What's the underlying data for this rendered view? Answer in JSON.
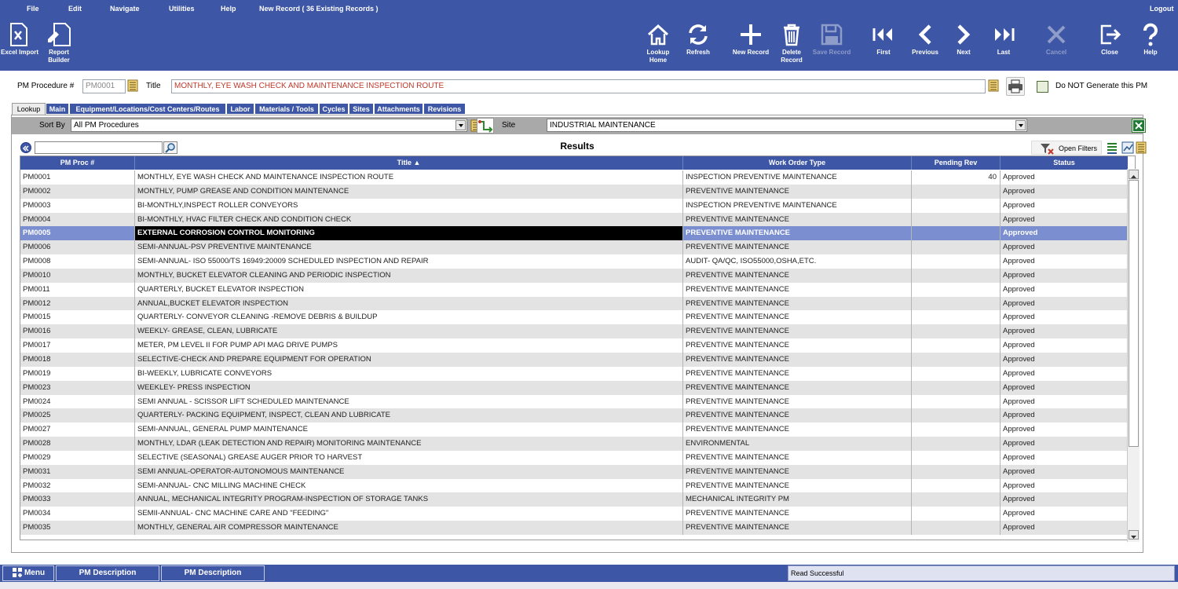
{
  "menu": {
    "file": "File",
    "edit": "Edit",
    "navigate": "Navigate",
    "utilities": "Utilities",
    "help": "Help",
    "record_info": "New Record  ( 36 Existing Records )",
    "logout": "Logout"
  },
  "toolbar": {
    "excel_import": "Excel Import",
    "report_builder_1": "Report",
    "report_builder_2": "Builder",
    "lookup_home_1": "Lookup",
    "lookup_home_2": "Home",
    "refresh": "Refresh",
    "new_record": "New Record",
    "delete_record_1": "Delete",
    "delete_record_2": "Record",
    "save_record": "Save Record",
    "first": "First",
    "previous": "Previous",
    "next": "Next",
    "last": "Last",
    "cancel": "Cancel",
    "close": "Close",
    "help": "Help"
  },
  "header": {
    "pm_procedure_label": "PM Procedure #",
    "pm_procedure_value": "PM0001",
    "title_label": "Title",
    "title_value": "MONTHLY,  EYE WASH CHECK AND MAINTENANCE INSPECTION ROUTE",
    "do_not_generate_label": "Do NOT Generate this PM"
  },
  "tabs": [
    "Lookup",
    "Main",
    "Equipment/Locations/Cost Centers/Routes",
    "Labor",
    "Materials / Tools",
    "Cycles",
    "Sites",
    "Attachments",
    "Revisions"
  ],
  "sortbar": {
    "sort_by_label": "Sort By",
    "sort_by_value": "All PM Procedures",
    "site_label": "Site",
    "site_value": "INDUSTRIAL  MAINTENANCE"
  },
  "results": {
    "title": "Results",
    "open_filters": "Open Filters",
    "columns": [
      "PM Proc #",
      "Title ▲",
      "Work Order Type",
      "Pending Rev",
      "Status"
    ]
  },
  "rows": [
    {
      "id": "PM0001",
      "title": "MONTHLY,  EYE WASH CHECK AND MAINTENANCE INSPECTION ROUTE",
      "type": "INSPECTION PREVENTIVE MAINTENANCE",
      "rev": "40",
      "status": "Approved"
    },
    {
      "id": "PM0002",
      "title": "MONTHLY, PUMP GREASE AND CONDITION MAINTENANCE",
      "type": "PREVENTIVE MAINTENANCE",
      "rev": "",
      "status": "Approved"
    },
    {
      "id": "PM0003",
      "title": "BI-MONTHLY,INSPECT ROLLER CONVEYORS",
      "type": "INSPECTION PREVENTIVE MAINTENANCE",
      "rev": "",
      "status": "Approved"
    },
    {
      "id": "PM0004",
      "title": "BI-MONTHLY, HVAC FILTER CHECK AND CONDITION CHECK",
      "type": "PREVENTIVE MAINTENANCE",
      "rev": "",
      "status": "Approved"
    },
    {
      "id": "PM0005",
      "title": "EXTERNAL CORROSION CONTROL MONITORING",
      "type": "PREVENTIVE MAINTENANCE",
      "rev": "",
      "status": "Approved",
      "selected": true
    },
    {
      "id": "PM0006",
      "title": "SEMI-ANNUAL-PSV PREVENTIVE MAINTENANCE",
      "type": "PREVENTIVE MAINTENANCE",
      "rev": "",
      "status": "Approved"
    },
    {
      "id": "PM0008",
      "title": "SEMI-ANNUAL- ISO 55000/TS 16949:20009 SCHEDULED INSPECTION AND REPAIR",
      "type": "AUDIT- QA/QC, ISO55000,OSHA,ETC.",
      "rev": "",
      "status": "Approved"
    },
    {
      "id": "PM0010",
      "title": "MONTHLY,  BUCKET ELEVATOR CLEANING AND PERIODIC INSPECTION",
      "type": "PREVENTIVE MAINTENANCE",
      "rev": "",
      "status": "Approved"
    },
    {
      "id": "PM0011",
      "title": "QUARTERLY, BUCKET ELEVATOR INSPECTION",
      "type": "PREVENTIVE MAINTENANCE",
      "rev": "",
      "status": "Approved"
    },
    {
      "id": "PM0012",
      "title": "ANNUAL,BUCKET ELEVATOR INSPECTION",
      "type": "PREVENTIVE MAINTENANCE",
      "rev": "",
      "status": "Approved"
    },
    {
      "id": "PM0015",
      "title": "QUARTERLY- CONVEYOR CLEANING -REMOVE DEBRIS & BUILDUP",
      "type": "PREVENTIVE MAINTENANCE",
      "rev": "",
      "status": "Approved"
    },
    {
      "id": "PM0016",
      "title": "WEEKLY- GREASE, CLEAN, LUBRICATE",
      "type": "PREVENTIVE MAINTENANCE",
      "rev": "",
      "status": "Approved"
    },
    {
      "id": "PM0017",
      "title": "METER, PM LEVEL II FOR PUMP  API MAG DRIVE PUMPS",
      "type": "PREVENTIVE MAINTENANCE",
      "rev": "",
      "status": "Approved"
    },
    {
      "id": "PM0018",
      "title": "SELECTIVE-CHECK AND PREPARE EQUIPMENT FOR OPERATION",
      "type": "PREVENTIVE MAINTENANCE",
      "rev": "",
      "status": "Approved"
    },
    {
      "id": "PM0019",
      "title": "BI-WEEKLY,  LUBRICATE CONVEYORS",
      "type": "PREVENTIVE MAINTENANCE",
      "rev": "",
      "status": "Approved"
    },
    {
      "id": "PM0023",
      "title": "WEEKLEY- PRESS INSPECTION",
      "type": "PREVENTIVE MAINTENANCE",
      "rev": "",
      "status": "Approved"
    },
    {
      "id": "PM0024",
      "title": "SEMI ANNUAL - SCISSOR LIFT SCHEDULED MAINTENANCE",
      "type": "PREVENTIVE MAINTENANCE",
      "rev": "",
      "status": "Approved"
    },
    {
      "id": "PM0025",
      "title": "QUARTERLY- PACKING EQUIPMENT, INSPECT, CLEAN AND LUBRICATE",
      "type": "PREVENTIVE MAINTENANCE",
      "rev": "",
      "status": "Approved"
    },
    {
      "id": "PM0027",
      "title": "SEMI-ANNUAL, GENERAL  PUMP MAINTENANCE",
      "type": "PREVENTIVE MAINTENANCE",
      "rev": "",
      "status": "Approved"
    },
    {
      "id": "PM0028",
      "title": "MONTHLY,  LDAR (LEAK DETECTION AND REPAIR) MONITORING MAINTENANCE",
      "type": "ENVIRONMENTAL",
      "rev": "",
      "status": "Approved"
    },
    {
      "id": "PM0029",
      "title": "SELECTIVE (SEASONAL) GREASE AUGER PRIOR TO HARVEST",
      "type": "PREVENTIVE MAINTENANCE",
      "rev": "",
      "status": "Approved"
    },
    {
      "id": "PM0031",
      "title": "SEMI ANNUAL-OPERATOR-AUTONOMOUS MAINTENANCE",
      "type": "PREVENTIVE MAINTENANCE",
      "rev": "",
      "status": "Approved"
    },
    {
      "id": "PM0032",
      "title": "SEMI-ANNUAL- CNC MILLING MACHINE CHECK",
      "type": "PREVENTIVE MAINTENANCE",
      "rev": "",
      "status": "Approved"
    },
    {
      "id": "PM0033",
      "title": "ANNUAL, MECHANICAL INTEGRITY PROGRAM-INSPECTION OF STORAGE TANKS",
      "type": "MECHANICAL INTEGRITY PM",
      "rev": "",
      "status": "Approved"
    },
    {
      "id": "PM0034",
      "title": "SEMII-ANNUAL- CNC MACHINE CARE AND \"FEEDING\"",
      "type": "PREVENTIVE MAINTENANCE",
      "rev": "",
      "status": "Approved"
    },
    {
      "id": "PM0035",
      "title": "MONTHLY, GENERAL AIR COMPRESSOR MAINTENANCE",
      "type": "PREVENTIVE MAINTENANCE",
      "rev": "",
      "status": "Approved"
    }
  ],
  "bottombar": {
    "menu": "Menu",
    "pm_description_1": "PM Description",
    "pm_description_2": "PM Description",
    "status": "Read Successful"
  },
  "colors": {
    "primary": "#3d56a6",
    "selected_row": "#7b8fd0",
    "alt_row": "#e3e3e3",
    "title_text": "#c0392b"
  }
}
